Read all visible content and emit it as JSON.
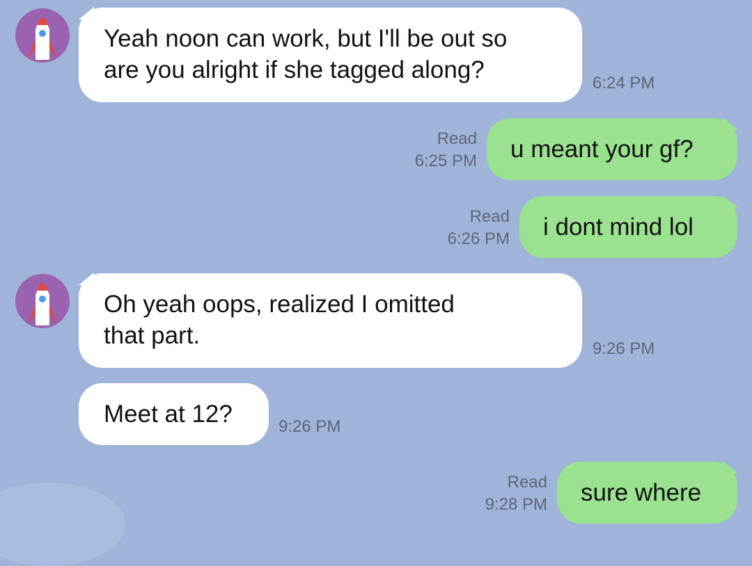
{
  "colors": {
    "background": "#a0b4da",
    "incoming_bubble": "#ffffff",
    "outgoing_bubble": "#9ae28f",
    "avatar": "#9a62b0",
    "meta_text": "#5b6679"
  },
  "contact": {
    "avatar_icon": "rocket-icon"
  },
  "messages": [
    {
      "direction": "incoming",
      "lines": [
        "Yeah noon can work, but I'll be out so",
        "are you alright if she tagged along?"
      ],
      "time": "6:24 PM"
    },
    {
      "direction": "outgoing",
      "text": "u meant your gf?",
      "status": "Read",
      "time": "6:25 PM"
    },
    {
      "direction": "outgoing",
      "text": "i dont mind lol",
      "status": "Read",
      "time": "6:26 PM"
    },
    {
      "direction": "incoming",
      "lines": [
        "Oh yeah oops, realized I omitted",
        "that part."
      ],
      "time": "9:26 PM"
    },
    {
      "direction": "incoming",
      "text": "Meet at 12?",
      "time": "9:26 PM"
    },
    {
      "direction": "outgoing",
      "text": "sure where",
      "status": "Read",
      "time": "9:28 PM"
    }
  ]
}
